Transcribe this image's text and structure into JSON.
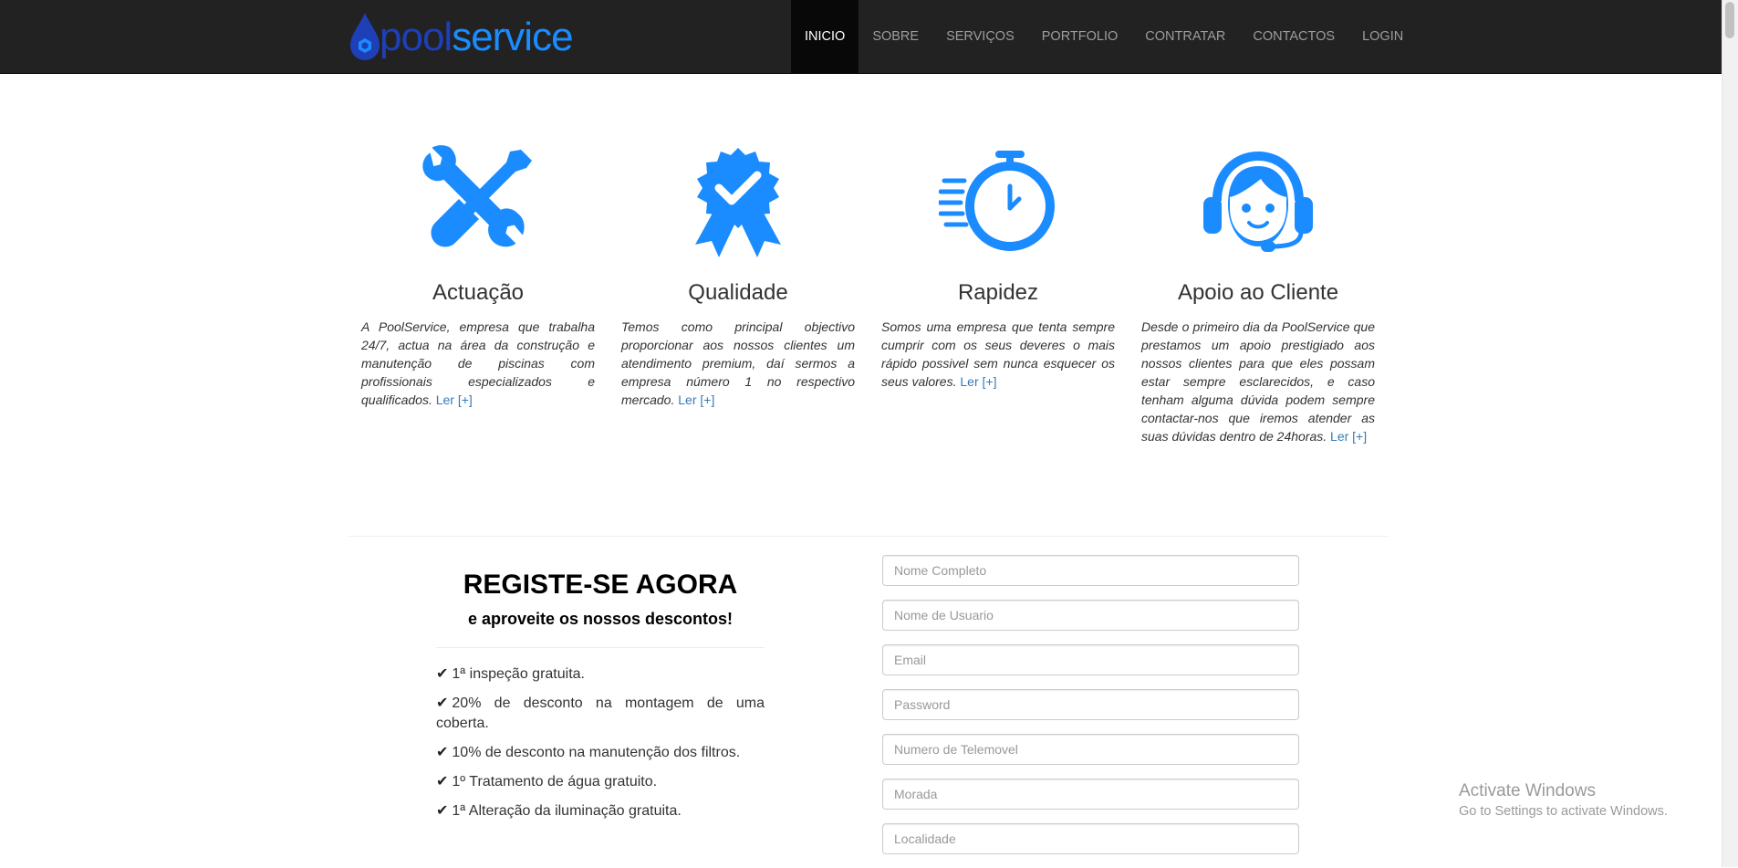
{
  "brand": {
    "part1": "pool",
    "part2": "service"
  },
  "nav": {
    "items": [
      {
        "label": "INICIO",
        "active": true
      },
      {
        "label": "SOBRE",
        "active": false
      },
      {
        "label": "SERVIÇOS",
        "active": false
      },
      {
        "label": "PORTFOLIO",
        "active": false
      },
      {
        "label": "CONTRATAR",
        "active": false
      },
      {
        "label": "CONTACTOS",
        "active": false
      },
      {
        "label": "LOGIN",
        "active": false
      }
    ]
  },
  "features": [
    {
      "icon": "wrench-screwdriver-icon",
      "title": "Actuação",
      "text": "A PoolService, empresa que trabalha 24/7, actua na área da construção e manutenção de piscinas com profissionais especializados e qualificados.",
      "link": "Ler [+]"
    },
    {
      "icon": "quality-badge-icon",
      "title": "Qualidade",
      "text": "Temos como principal objectivo proporcionar aos nossos clientes um atendimento premium, daí sermos a empresa número 1 no respectivo mercado.",
      "link": "Ler [+]"
    },
    {
      "icon": "stopwatch-icon",
      "title": "Rapidez",
      "text": "Somos uma empresa que tenta sempre cumprir com os seus deveres o mais rápido possivel sem nunca esquecer os seus valores.",
      "link": "Ler [+]"
    },
    {
      "icon": "headset-agent-icon",
      "title": "Apoio ao Cliente",
      "text": "Desde o primeiro dia da PoolService que prestamos um apoio prestigiado aos nossos clientes para que eles possam estar sempre esclarecidos, e caso tenham alguma dúvida podem sempre contactar-nos que iremos atender as suas dúvidas dentro de 24horas.",
      "link": "Ler [+]"
    }
  ],
  "register": {
    "title": "REGISTE-SE AGORA",
    "subtitle": "e aproveite os nossos descontos!",
    "check_glyph": "✔",
    "benefits": [
      "1ª inspeção gratuita.",
      "20% de desconto na montagem de uma coberta.",
      "10% de desconto na manutenção dos filtros.",
      "1º Tratamento de água gratuito.",
      "1ª Alteração da iluminação gratuita."
    ]
  },
  "form": {
    "fields": [
      {
        "placeholder": "Nome Completo",
        "value": ""
      },
      {
        "placeholder": "Nome de Usuario",
        "value": ""
      },
      {
        "placeholder": "Email",
        "value": ""
      },
      {
        "placeholder": "Password",
        "value": ""
      },
      {
        "placeholder": "Numero de Telemovel",
        "value": ""
      },
      {
        "placeholder": "Morada",
        "value": ""
      },
      {
        "placeholder": "Localidade",
        "value": ""
      }
    ]
  },
  "watermark": {
    "title": "Activate Windows",
    "subtitle": "Go to Settings to activate Windows."
  },
  "colors": {
    "accent": "#1a8cff",
    "navbar": "#222222",
    "link": "#337ab7",
    "brand_dark": "#1e3fb8"
  }
}
